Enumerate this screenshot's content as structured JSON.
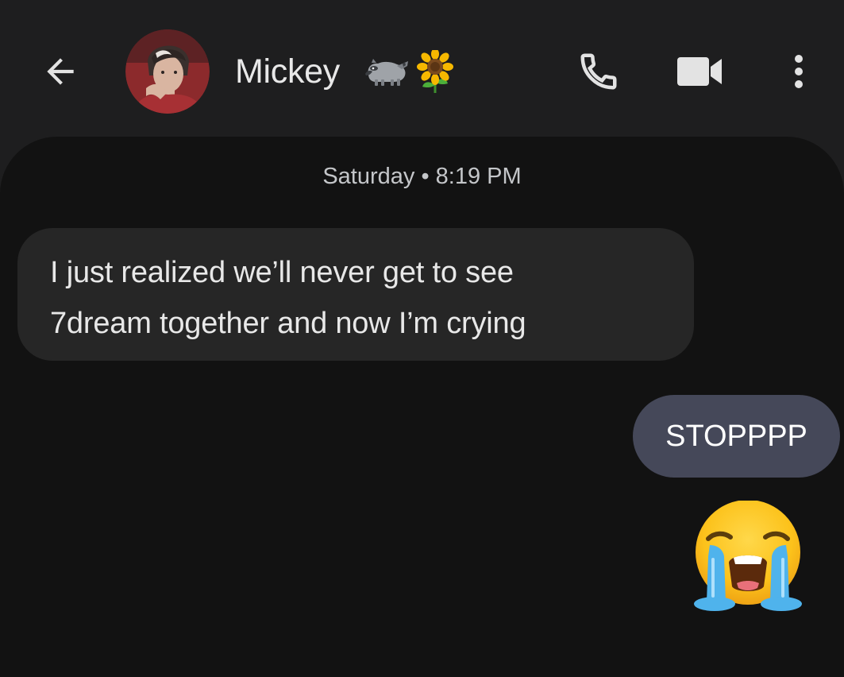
{
  "header": {
    "contact_name": "Mickey",
    "name_emojis": [
      "raccoon",
      "sunflower"
    ],
    "back_icon": "arrow-left-icon",
    "call_icon": "phone-icon",
    "video_icon": "video-camera-icon",
    "more_icon": "more-vert-icon"
  },
  "conversation": {
    "date_header": "Saturday • 8:19 PM",
    "messages": [
      {
        "direction": "incoming",
        "lines": [
          "I just realized we’ll never get to see",
          "7dream together and now I’m crying"
        ]
      },
      {
        "direction": "outgoing",
        "text": "STOPPPP"
      },
      {
        "direction": "outgoing",
        "emoji": "loudly-crying-face"
      }
    ]
  },
  "colors": {
    "header_bg": "#1e1e1f",
    "conversation_bg": "#121212",
    "incoming_bubble": "#262626",
    "outgoing_bubble": "#454859",
    "icon": "#e3e3e3"
  }
}
